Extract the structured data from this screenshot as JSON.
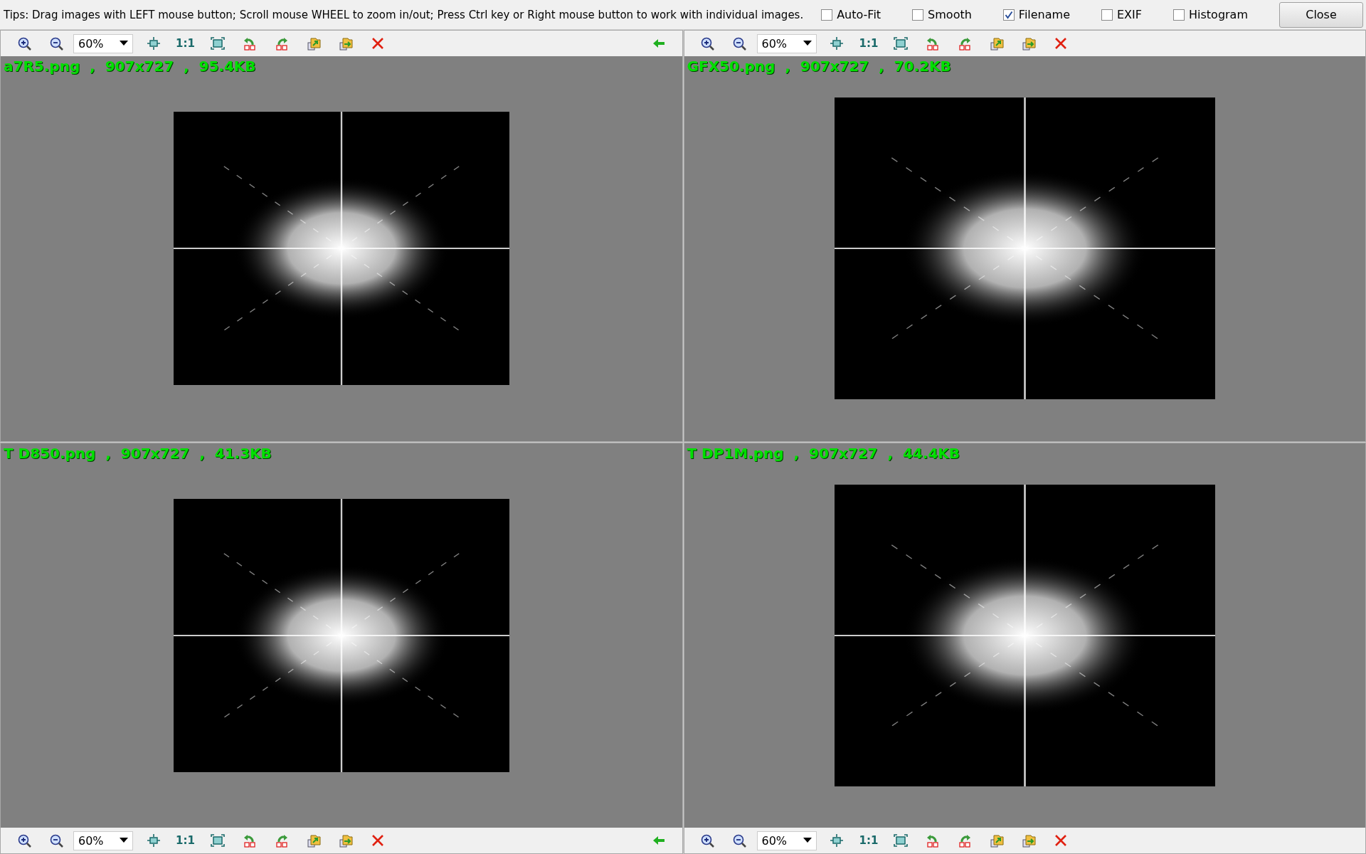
{
  "tips": "Tips: Drag images with LEFT mouse button; Scroll mouse WHEEL to zoom in/out; Press Ctrl key or Right mouse button to work with individual images.",
  "options": [
    {
      "label": "Auto-Fit",
      "checked": false
    },
    {
      "label": "Smooth",
      "checked": false
    },
    {
      "label": "Filename",
      "checked": true
    },
    {
      "label": "EXIF",
      "checked": false
    },
    {
      "label": "Histogram",
      "checked": false
    }
  ],
  "close_button": "Close",
  "panels": [
    {
      "caption": "a7R5.png  ,  907x727  ,  95.4KB",
      "kind": "top",
      "zoom": "60%",
      "actual_size": "1:1",
      "back_arrow": true
    },
    {
      "caption": "GFX50.png  ,  907x727  ,  70.2KB",
      "kind": "top",
      "zoom": "60%",
      "actual_size": "1:1",
      "back_arrow": false
    },
    {
      "caption": "T D850.png  ,  907x727  ,  41.3KB",
      "kind": "bottom",
      "zoom": "60%",
      "actual_size": "1:1",
      "back_arrow": true
    },
    {
      "caption": "T DP1M.png  ,  907x727  ,  44.4KB",
      "kind": "bottom",
      "zoom": "60%",
      "actual_size": "1:1",
      "back_arrow": false
    }
  ]
}
